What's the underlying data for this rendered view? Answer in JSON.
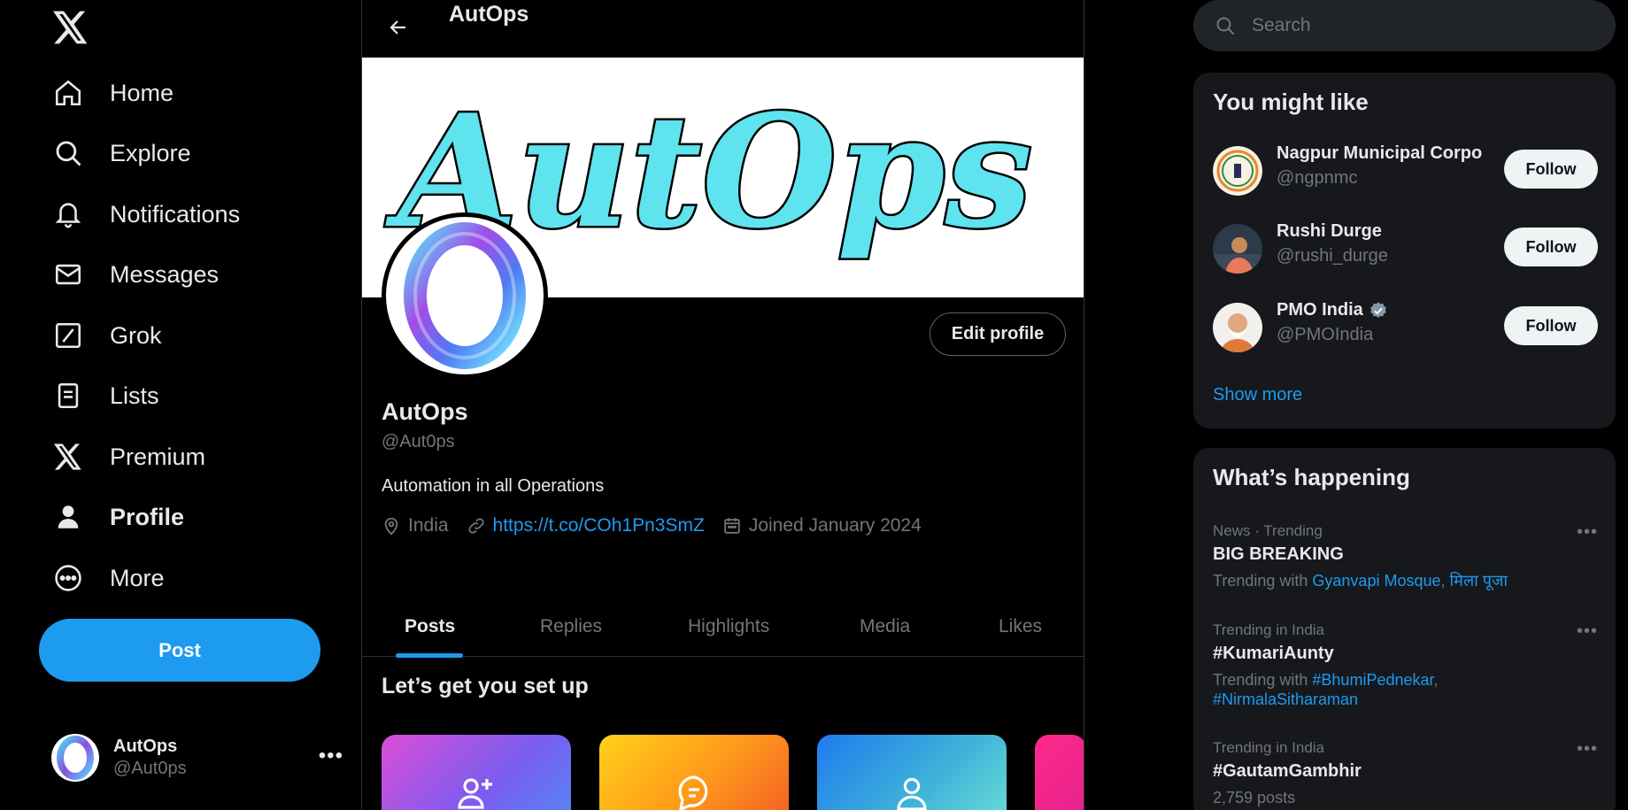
{
  "nav": {
    "items": [
      {
        "label": "Home",
        "icon": "home-icon"
      },
      {
        "label": "Explore",
        "icon": "search-icon"
      },
      {
        "label": "Notifications",
        "icon": "bell-icon"
      },
      {
        "label": "Messages",
        "icon": "envelope-icon"
      },
      {
        "label": "Grok",
        "icon": "grok-icon"
      },
      {
        "label": "Lists",
        "icon": "list-icon"
      },
      {
        "label": "Premium",
        "icon": "x-logo-icon"
      },
      {
        "label": "Profile",
        "icon": "person-icon"
      },
      {
        "label": "More",
        "icon": "more-circle-icon"
      }
    ],
    "post_label": "Post"
  },
  "account": {
    "name": "AutOps",
    "handle": "@Aut0ps",
    "menu": "•••"
  },
  "header": {
    "title": "AutOps"
  },
  "profile": {
    "banner_text": "AutOps",
    "edit_label": "Edit profile",
    "name": "AutOps",
    "handle": "@Aut0ps",
    "bio": "Automation in all Operations",
    "location": "India",
    "url": "https://t.co/COh1Pn3SmZ",
    "joined": "Joined January 2024"
  },
  "tabs": [
    "Posts",
    "Replies",
    "Highlights",
    "Media",
    "Likes"
  ],
  "setup": {
    "title": "Let’s get you set up"
  },
  "search": {
    "placeholder": "Search"
  },
  "suggestions": {
    "title": "You might like",
    "follow_label": "Follow",
    "show_more": "Show more",
    "people": [
      {
        "name": "Nagpur Municipal Corpo",
        "handle": "@ngpnmc",
        "verified": false
      },
      {
        "name": "Rushi Durge",
        "handle": "@rushi_durge",
        "verified": false
      },
      {
        "name": "PMO India",
        "handle": "@PMOIndia",
        "verified": true
      }
    ]
  },
  "trending": {
    "title": "What’s happening",
    "trending_with": "Trending with",
    "items": [
      {
        "context": "News · Trending",
        "name": "BIG BREAKING",
        "with": [
          "Gyanvapi Mosque",
          "मिला पूजा"
        ]
      },
      {
        "context": "Trending in India",
        "name": "#KumariAunty",
        "with": [
          "#BhumiPednekar",
          "#NirmalaSitharaman"
        ]
      },
      {
        "context": "Trending in India",
        "name": "#GautamGambhir",
        "posts": "2,759 posts"
      }
    ]
  },
  "colors": {
    "accent": "#1d9bf0",
    "background": "#000000",
    "panel": "#16181c",
    "text_secondary": "#71767b"
  }
}
